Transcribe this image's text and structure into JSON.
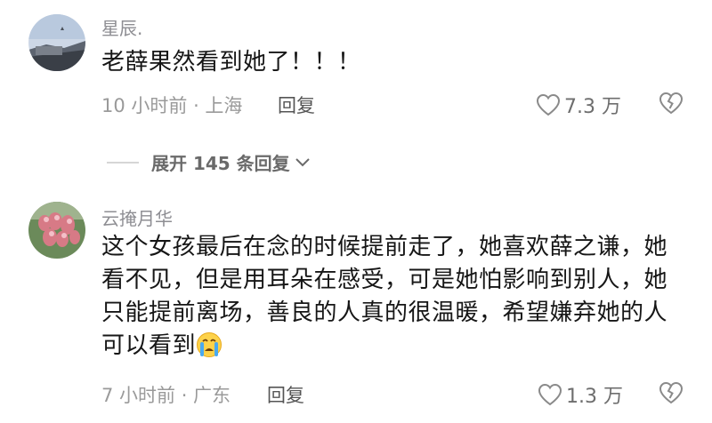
{
  "comments": [
    {
      "username": "星辰.",
      "text": "老薛果然看到她了！！！",
      "time_location": "10 小时前 · 上海",
      "reply_label": "回复",
      "likes": "7.3 万"
    },
    {
      "username": "云掩月华",
      "text": "这个女孩最后在念的时候提前走了，她喜欢薛之谦，她看不见，但是用耳朵在感受，可是她怕影响到别人，她只能提前离场，善良的人真的很温暖，希望嫌弃她的人可以看到",
      "emoji": "crying-face",
      "time_location": "7 小时前 · 广东",
      "reply_label": "回复",
      "likes": "1.3 万"
    }
  ],
  "expand_replies": "展开 145 条回复",
  "icons": [
    "heart-outline-icon",
    "broken-heart-icon",
    "chevron-down-icon",
    "crying-face-emoji"
  ],
  "colors": {
    "text": "#161616",
    "meta": "#9a9a9a",
    "username": "#8e8e93"
  }
}
